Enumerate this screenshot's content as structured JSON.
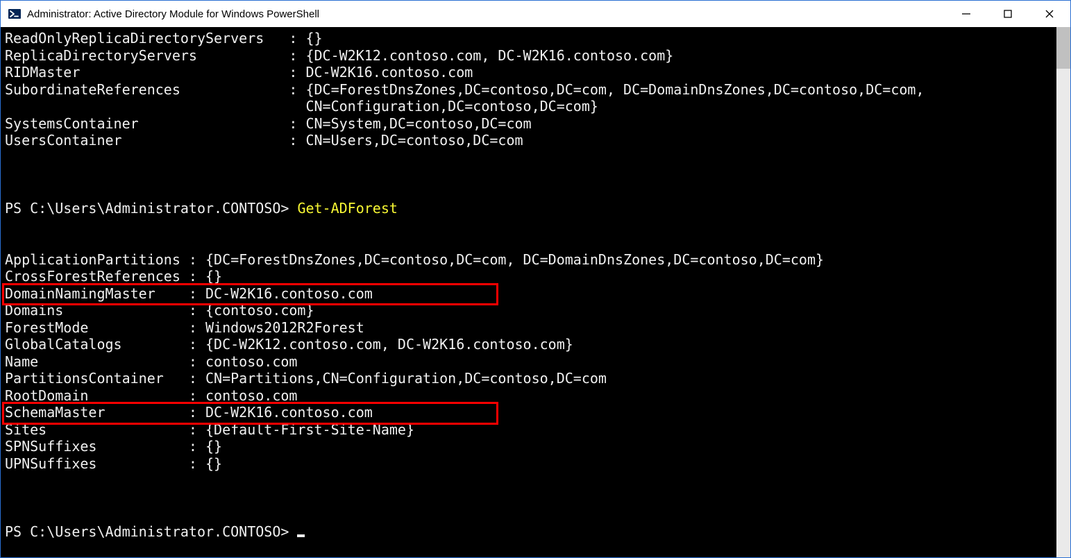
{
  "window": {
    "title": "Administrator: Active Directory Module for Windows PowerShell"
  },
  "top": {
    "lines": [
      "ReadOnlyReplicaDirectoryServers   : {}",
      "ReplicaDirectoryServers           : {DC-W2K12.contoso.com, DC-W2K16.contoso.com}",
      "RIDMaster                         : DC-W2K16.contoso.com",
      "SubordinateReferences             : {DC=ForestDnsZones,DC=contoso,DC=com, DC=DomainDnsZones,DC=contoso,DC=com,",
      "                                    CN=Configuration,DC=contoso,DC=com}",
      "SystemsContainer                  : CN=System,DC=contoso,DC=com",
      "UsersContainer                    : CN=Users,DC=contoso,DC=com"
    ]
  },
  "prompt1": {
    "path": "PS C:\\Users\\Administrator.CONTOSO> ",
    "cmd": "Get-ADForest"
  },
  "forest": {
    "lines": [
      "ApplicationPartitions : {DC=ForestDnsZones,DC=contoso,DC=com, DC=DomainDnsZones,DC=contoso,DC=com}",
      "CrossForestReferences : {}",
      "DomainNamingMaster    : DC-W2K16.contoso.com",
      "Domains               : {contoso.com}",
      "ForestMode            : Windows2012R2Forest",
      "GlobalCatalogs        : {DC-W2K12.contoso.com, DC-W2K16.contoso.com}",
      "Name                  : contoso.com",
      "PartitionsContainer   : CN=Partitions,CN=Configuration,DC=contoso,DC=com",
      "RootDomain            : contoso.com",
      "SchemaMaster          : DC-W2K16.contoso.com",
      "Sites                 : {Default-First-Site-Name}",
      "SPNSuffixes           : {}",
      "UPNSuffixes           : {}"
    ]
  },
  "prompt2": {
    "path": "PS C:\\Users\\Administrator.CONTOSO> "
  }
}
